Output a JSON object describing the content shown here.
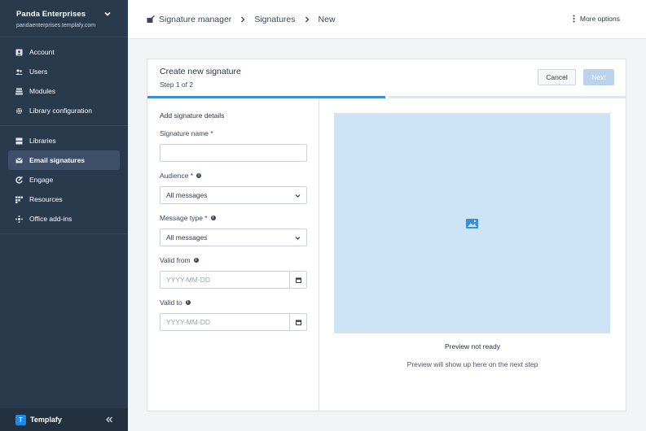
{
  "sidebar": {
    "org_name": "Panda Enterprises",
    "org_domain": "pandaenterprises.templafy.com",
    "groups": [
      [
        {
          "label": "Account",
          "icon": "account-icon"
        },
        {
          "label": "Users",
          "icon": "users-icon"
        },
        {
          "label": "Modules",
          "icon": "modules-icon"
        },
        {
          "label": "Library configuration",
          "icon": "gear-icon"
        }
      ],
      [
        {
          "label": "Libraries",
          "icon": "libraries-icon"
        },
        {
          "label": "Email signatures",
          "icon": "email-signature-icon",
          "active": true
        },
        {
          "label": "Engage",
          "icon": "engage-icon"
        },
        {
          "label": "Resources",
          "icon": "resources-icon"
        },
        {
          "label": "Office add-ins",
          "icon": "office-addins-icon"
        }
      ]
    ],
    "brand_letter": "T",
    "brand_name": "Templafy"
  },
  "topbar": {
    "breadcrumbs": [
      "Signature manager",
      "Signatures",
      "New"
    ],
    "more_label": "More options"
  },
  "card": {
    "title": "Create new signature",
    "step": "Step 1 of 2",
    "cancel_label": "Cancel",
    "next_label": "Next",
    "progress_steps": 2,
    "progress_current": 1
  },
  "form": {
    "section_title": "Add signature details",
    "name_label": "Signature name *",
    "name_value": "",
    "audience_label": "Audience *",
    "audience_value": "All messages",
    "message_type_label": "Message type *",
    "message_type_value": "All messages",
    "valid_from_label": "Valid from",
    "valid_from_placeholder": "YYYY-MM-DD",
    "valid_to_label": "Valid to",
    "valid_to_placeholder": "YYYY-MM-DD"
  },
  "preview": {
    "title": "Preview not ready",
    "subtitle": "Preview will show up here on the next step"
  },
  "colors": {
    "sidebar_bg": "#293a4d",
    "active_item": "#3d5068",
    "accent": "#3b8fd6",
    "preview_bg": "#cde3f6",
    "next_disabled": "#b9d3ec"
  }
}
